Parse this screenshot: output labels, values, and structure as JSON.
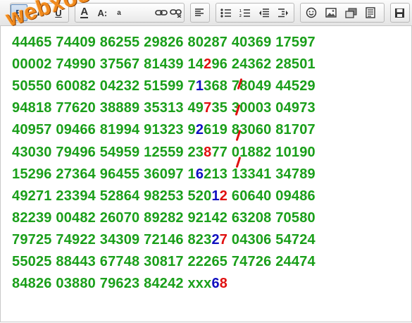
{
  "toolbar": {
    "buttons": [
      {
        "name": "bold-button",
        "glyph": "B"
      },
      {
        "name": "italic-button",
        "glyph": "I"
      },
      {
        "name": "underline-button",
        "glyph": "U"
      },
      {
        "name": "text-color-button",
        "glyph": "A"
      },
      {
        "name": "font-size-button",
        "glyph": "A:"
      },
      {
        "name": "superscript-button",
        "glyph": "a"
      },
      {
        "name": "link-button",
        "glyph": "link-icon"
      },
      {
        "name": "unlink-button",
        "glyph": "unlink-icon"
      },
      {
        "name": "align-left-button",
        "glyph": "align-left-icon"
      },
      {
        "name": "bullet-list-button",
        "glyph": "bullet-list-icon"
      },
      {
        "name": "numbered-list-button",
        "glyph": "numbered-list-icon"
      },
      {
        "name": "outdent-button",
        "glyph": "outdent-icon"
      },
      {
        "name": "indent-button",
        "glyph": "indent-icon"
      },
      {
        "name": "emoji-button",
        "glyph": "smiley-icon"
      },
      {
        "name": "image-button",
        "glyph": "image-icon"
      },
      {
        "name": "media-button",
        "glyph": "gallery-icon"
      },
      {
        "name": "page-break-button",
        "glyph": "document-icon"
      },
      {
        "name": "save-button",
        "glyph": "save-icon"
      }
    ]
  },
  "watermark": "webxoso.net",
  "editor": {
    "lines": [
      [
        {
          "t": "44465 "
        },
        {
          "t": "74409 86255 29826 80287 40369 17597"
        }
      ],
      [
        {
          "t": "00002 74990 37567 81439 14"
        },
        {
          "t": "2",
          "c": "r"
        },
        {
          "t": "96 24362 28501"
        }
      ],
      [
        {
          "t": "50550 60082 04232 51599 7"
        },
        {
          "t": "1",
          "c": "b"
        },
        {
          "t": "368 78049 44529"
        }
      ],
      [
        {
          "t": "94818 77620 38889 35313 49"
        },
        {
          "t": "7",
          "c": "r"
        },
        {
          "t": "35 30003 04973"
        }
      ],
      [
        {
          "t": "40957 09466 81994 91323 9"
        },
        {
          "t": "2",
          "c": "b"
        },
        {
          "t": "619 83060 81707"
        }
      ],
      [
        {
          "t": "43030 79496 54959 12559 23"
        },
        {
          "t": "8",
          "c": "r"
        },
        {
          "t": "77 01882 10190"
        }
      ],
      [
        {
          "t": "15296 27364 96455 36097 1"
        },
        {
          "t": "6",
          "c": "b"
        },
        {
          "t": "213 13341 34789"
        }
      ],
      [
        {
          "t": "49271 23394 52864 98253 520"
        },
        {
          "t": "1",
          "c": "b"
        },
        {
          "t": "2",
          "c": "r"
        },
        {
          "t": " 60640 09486"
        }
      ],
      [
        {
          "t": "82239 00482 26070 89282 92142 63208 70580"
        }
      ],
      [
        {
          "t": "79725 74922 34309 72146 823"
        },
        {
          "t": "2",
          "c": "b"
        },
        {
          "t": "7",
          "c": "r"
        },
        {
          "t": " 04306 54724"
        }
      ],
      [
        {
          "t": "55025 88443 67748 30817 22265 74726 24474"
        }
      ],
      [
        {
          "t": "84826 03880 79623 84242 xxx"
        },
        {
          "t": "6",
          "c": "b"
        },
        {
          "t": "8",
          "c": "r"
        }
      ]
    ]
  }
}
